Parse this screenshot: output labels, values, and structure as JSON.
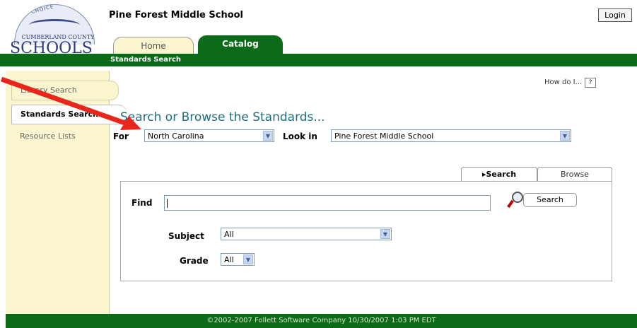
{
  "header": {
    "school_name": "Pine Forest Middle School",
    "login_label": "Login",
    "logo": {
      "word": "SCHOOLS",
      "sub": "CUMBERLAND COUNTY",
      "arc": "THE SCHOOL SYSTEM OF CHOICE"
    }
  },
  "tabs": [
    {
      "label": "Home",
      "active": false
    },
    {
      "label": "Catalog",
      "active": true
    }
  ],
  "breadcrumb": "Standards Search",
  "sidebar": {
    "items": [
      {
        "label": "Library Search",
        "active": false
      },
      {
        "label": "Standards Search",
        "active": true
      },
      {
        "label": "Resource Lists",
        "active": false
      }
    ]
  },
  "help": {
    "label": "How do I...",
    "icon": "?"
  },
  "main": {
    "title": "Search or Browse the Standards...",
    "for_label": "For",
    "for_value": "North Carolina",
    "lookin_label": "Look in",
    "lookin_value": "Pine Forest Middle School"
  },
  "panel_tabs": [
    {
      "label": "▸Search",
      "active": true
    },
    {
      "label": "Browse",
      "active": false
    }
  ],
  "search": {
    "find_label": "Find",
    "find_value": "",
    "button_label": "Search",
    "subject_label": "Subject",
    "subject_value": "All",
    "grade_label": "Grade",
    "grade_value": "All"
  },
  "footer": {
    "text": "©2002-2007 Follett Software Company    10/30/2007 1:03 PM EDT"
  },
  "colors": {
    "green": "#0b6b18",
    "sidebar": "#fbf6d0",
    "title": "#1e6e7e",
    "annotation_arrow": "#e8261c"
  }
}
